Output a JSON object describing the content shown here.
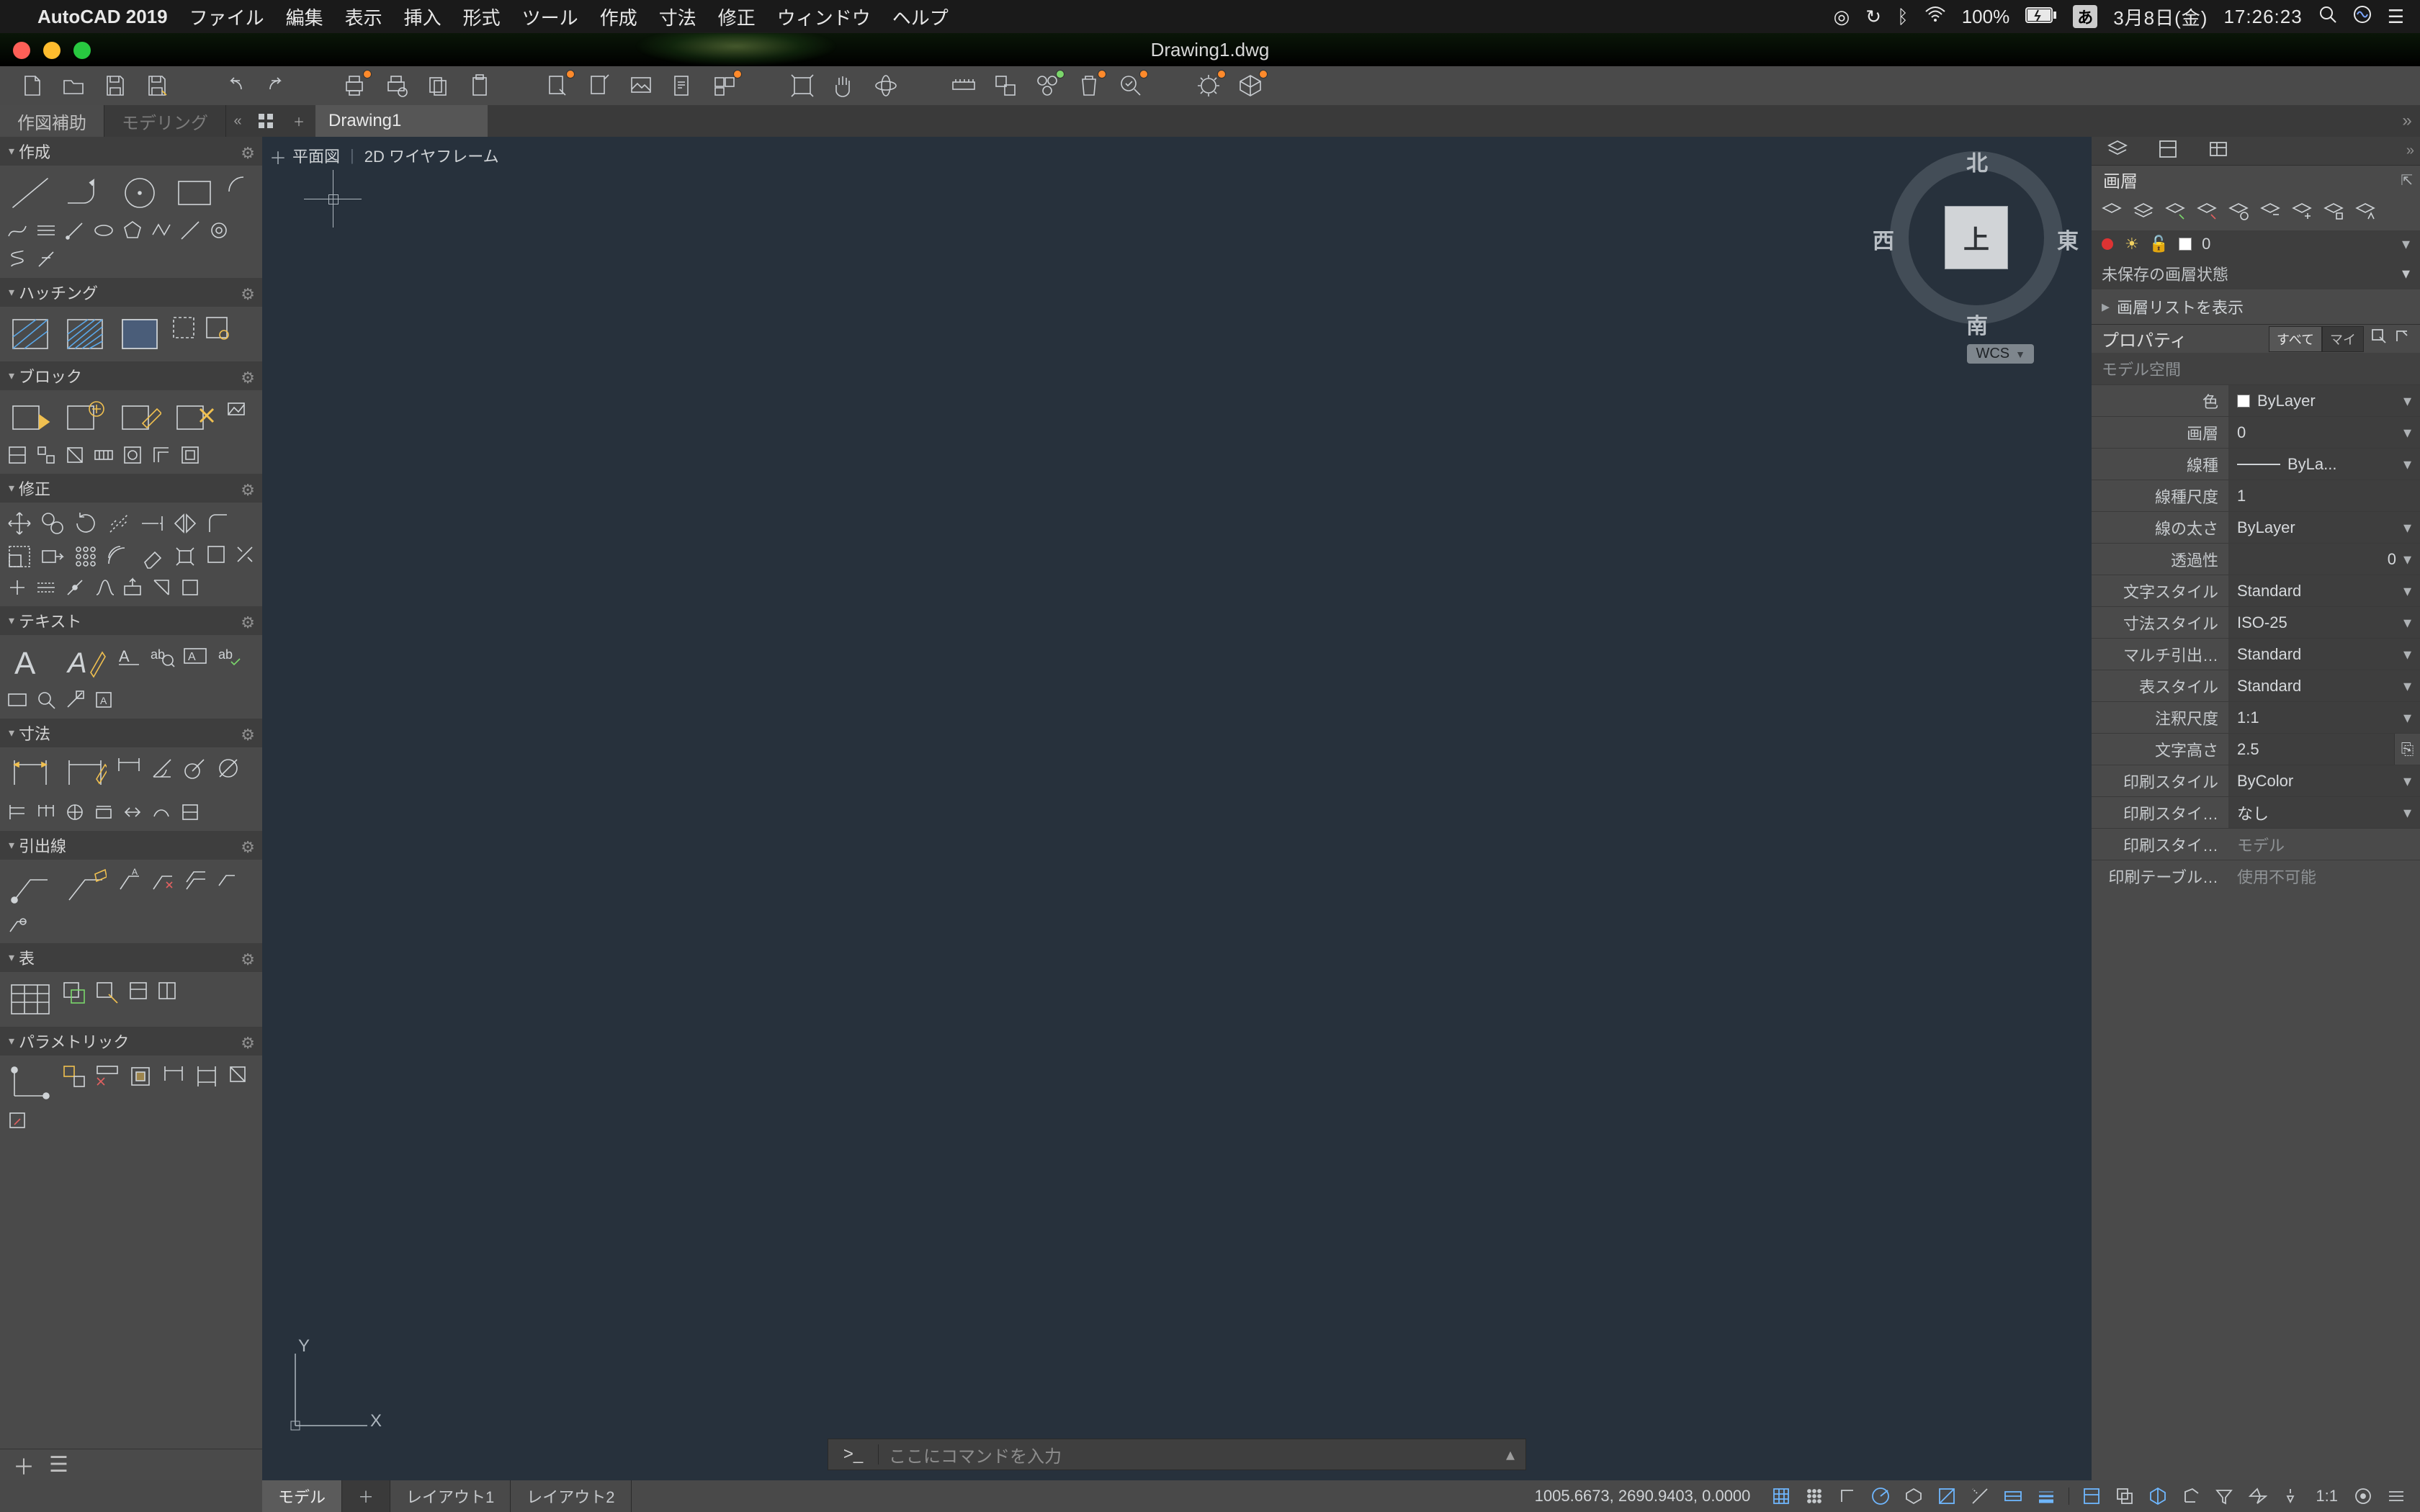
{
  "mac": {
    "app_name": "AutoCAD 2019",
    "menus": [
      "ファイル",
      "編集",
      "表示",
      "挿入",
      "形式",
      "ツール",
      "作成",
      "寸法",
      "修正",
      "ウィンドウ",
      "ヘルプ"
    ],
    "battery": "100%",
    "ime": "あ",
    "date": "3月8日(金)",
    "time": "17:26:23"
  },
  "doc_title": "Drawing1.dwg",
  "mode_tabs": {
    "active": "作図補助",
    "inactive": "モデリング"
  },
  "file_tabs": {
    "current": "Drawing1"
  },
  "viewport": {
    "view": "平面図",
    "style": "2D ワイヤフレーム"
  },
  "viewcube": {
    "top": "上",
    "north": "北",
    "south": "南",
    "east": "東",
    "west": "西",
    "wcs": "WCS"
  },
  "ucs_axes": {
    "x": "X",
    "y": "Y"
  },
  "command": {
    "prompt": ">_",
    "placeholder": "ここにコマンドを入力"
  },
  "panels": {
    "create": "作成",
    "hatch": "ハッチング",
    "block": "ブロック",
    "modify": "修正",
    "text": "テキスト",
    "dim": "寸法",
    "leader": "引出線",
    "table": "表",
    "param": "パラメトリック"
  },
  "right": {
    "layer_title": "画層",
    "layer_current": "0",
    "layer_state": "未保存の画層状態",
    "layer_list": "画層リストを表示",
    "props_title": "プロパティ",
    "tabs_all": "すべて",
    "tabs_my": "マイ",
    "mspace": "モデル空間",
    "rows": {
      "color": {
        "label": "色",
        "value": "ByLayer"
      },
      "layer": {
        "label": "画層",
        "value": "0"
      },
      "ltype": {
        "label": "線種",
        "value": "ByLa..."
      },
      "ltscale": {
        "label": "線種尺度",
        "value": "1"
      },
      "lweight": {
        "label": "線の太さ",
        "value": "ByLayer"
      },
      "transp": {
        "label": "透過性",
        "value": "0"
      },
      "tstyle": {
        "label": "文字スタイル",
        "value": "Standard"
      },
      "dstyle": {
        "label": "寸法スタイル",
        "value": "ISO-25"
      },
      "mleader": {
        "label": "マルチ引出…",
        "value": "Standard"
      },
      "tblstyle": {
        "label": "表スタイル",
        "value": "Standard"
      },
      "annosc": {
        "label": "注釈尺度",
        "value": "1:1"
      },
      "theight": {
        "label": "文字高さ",
        "value": "2.5"
      },
      "pstyle": {
        "label": "印刷スタイル",
        "value": "ByColor"
      },
      "pstylen": {
        "label": "印刷スタイ…",
        "value": "なし"
      },
      "pstylem": {
        "label": "印刷スタイ…",
        "value": "モデル"
      },
      "ptable": {
        "label": "印刷テーブル…",
        "value": "使用不可能"
      }
    }
  },
  "layout_tabs": {
    "model": "モデル",
    "l1": "レイアウト1",
    "l2": "レイアウト2"
  },
  "status": {
    "coord": "1005.6673, 2690.9403, 0.0000",
    "ratio": "1:1"
  }
}
